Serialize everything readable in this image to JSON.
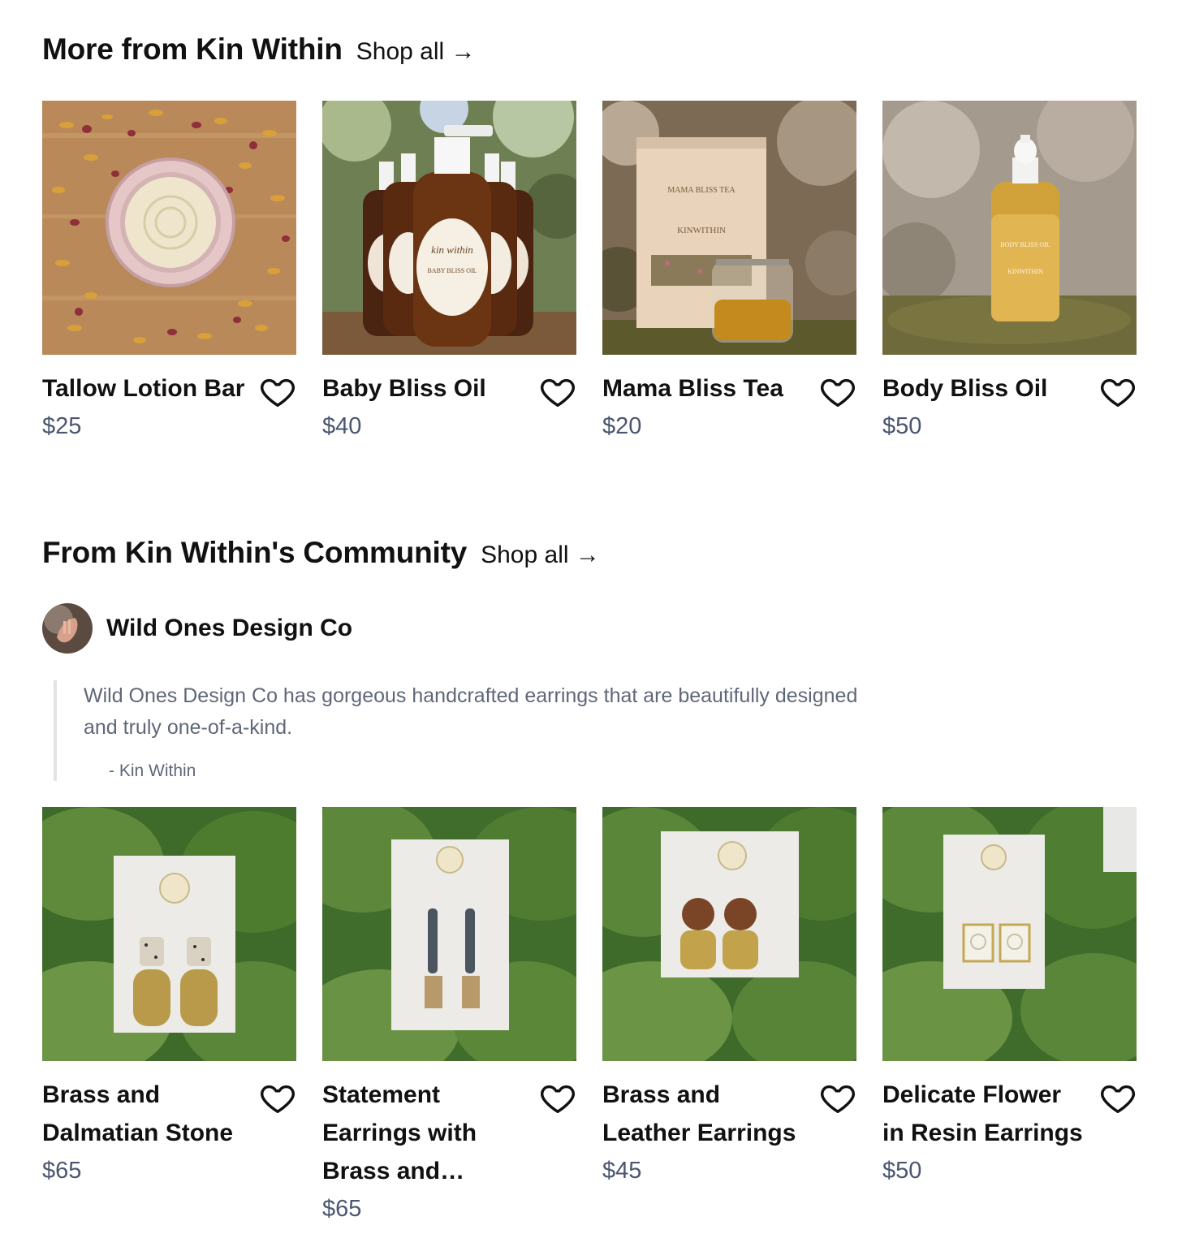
{
  "section1": {
    "title": "More from Kin Within",
    "shop_all": "Shop all →"
  },
  "products1": [
    {
      "name": "Tallow Lotion Bar",
      "price": "$25"
    },
    {
      "name": "Baby Bliss Oil",
      "price": "$40",
      "image_text": [
        "kin within",
        "BABY BLISS OIL"
      ]
    },
    {
      "name": "Mama Bliss Tea",
      "price": "$20",
      "image_text": [
        "MAMA BLISS TEA",
        "KINWITHIN"
      ]
    },
    {
      "name": "Body Bliss Oil",
      "price": "$50",
      "image_text": [
        "BODY BLISS OIL",
        "KINWITHIN"
      ]
    }
  ],
  "section2": {
    "title": "From Kin Within's Community",
    "shop_all": "Shop all →"
  },
  "seller": {
    "name": "Wild Ones Design Co",
    "quote": "Wild Ones Design Co has gorgeous handcrafted earrings that are beautifully designed and truly one-of-a-kind.",
    "author": "- Kin Within"
  },
  "products2": [
    {
      "name": "Brass and Dalmatian Stone",
      "price": "$65"
    },
    {
      "name": "Statement Earrings with Brass and…",
      "price": "$65"
    },
    {
      "name": "Brass and Leather Earrings",
      "price": "$45"
    },
    {
      "name": "Delicate Flower in Resin Earrings",
      "price": "$50"
    }
  ],
  "colors": {
    "price": "#4b5670",
    "quote_text": "#5f6778",
    "quote_border": "#e3e3e3"
  }
}
